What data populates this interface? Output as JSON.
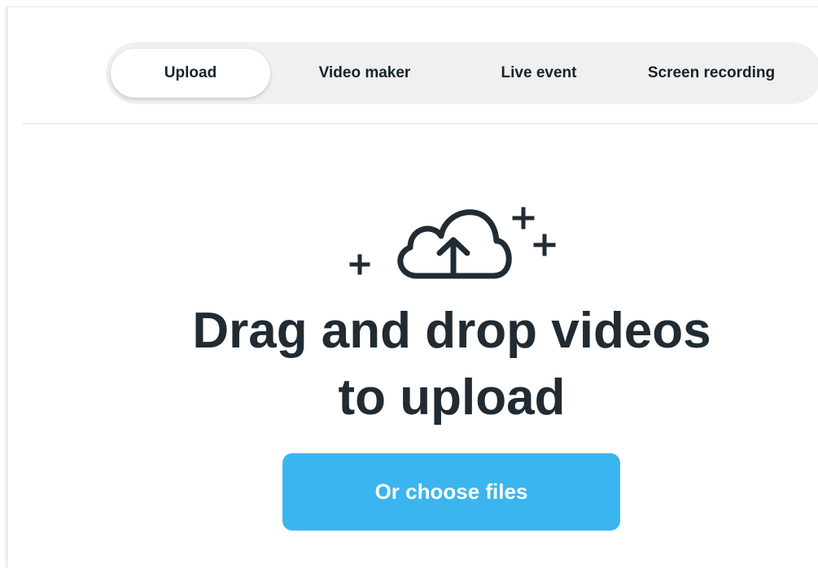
{
  "tabs": {
    "upload": "Upload",
    "video_maker": "Video maker",
    "live_event": "Live event",
    "screen_recording": "Screen recording",
    "active": "upload"
  },
  "dropzone": {
    "headline": "Drag and drop videos to upload",
    "choose_button": "Or choose files",
    "icon": "cloud-upload-icon"
  },
  "colors": {
    "accent": "#3bb5ef",
    "text": "#202b33",
    "tab_bg": "#f0f0f0"
  }
}
